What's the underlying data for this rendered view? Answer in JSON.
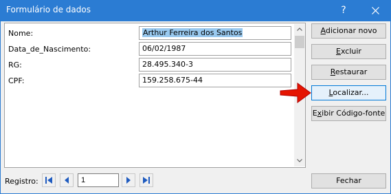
{
  "window": {
    "title": "Formulário de dados",
    "help_label": "?"
  },
  "fields": [
    {
      "label": "Nome:",
      "value": "Arthur Ferreira dos Santos",
      "selected": true
    },
    {
      "label": "Data_de_Nascimento:",
      "value": "06/02/1987",
      "selected": false
    },
    {
      "label": "RG:",
      "value": "28.495.340-3",
      "selected": false
    },
    {
      "label": "CPF:",
      "value": "159.258.675-44",
      "selected": false
    }
  ],
  "buttons": {
    "adicionar_novo": {
      "pre": "",
      "u": "A",
      "post": "dicionar novo"
    },
    "excluir": {
      "pre": "",
      "u": "E",
      "post": "xcluir"
    },
    "restaurar": {
      "pre": "",
      "u": "R",
      "post": "estaurar"
    },
    "localizar": {
      "pre": "",
      "u": "L",
      "post": "ocalizar..."
    },
    "exibir_codigo": {
      "pre": "E",
      "u": "x",
      "post": "ibir Código-fonte"
    },
    "fechar": {
      "pre": "",
      "u": "",
      "post": "Fechar"
    }
  },
  "navigation": {
    "registro_label": "Registro:",
    "current_record": "1"
  },
  "colors": {
    "titlebar": "#2b7cd3",
    "selection": "#99c9ef",
    "annotation_arrow": "#e51400"
  },
  "icons": [
    "help-icon",
    "close-icon",
    "scroll-up-icon",
    "scroll-down-icon",
    "first-record-icon",
    "previous-record-icon",
    "next-record-icon",
    "last-record-icon",
    "red-pointer-arrow"
  ]
}
